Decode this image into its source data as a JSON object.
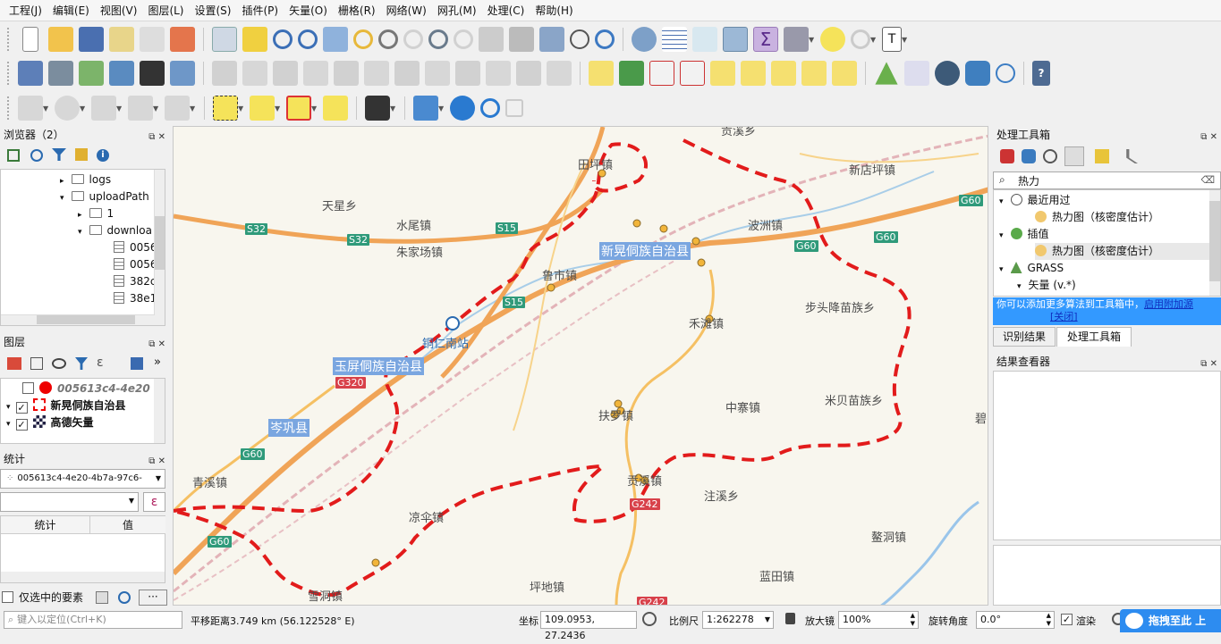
{
  "menus": [
    "工程(J)",
    "编辑(E)",
    "视图(V)",
    "图层(L)",
    "设置(S)",
    "插件(P)",
    "矢量(O)",
    "栅格(R)",
    "网络(W)",
    "网孔(M)",
    "处理(C)",
    "帮助(H)"
  ],
  "browser": {
    "title": "浏览器（2）",
    "items": [
      {
        "label": "logs",
        "kind": "folder"
      },
      {
        "label": "uploadPath",
        "kind": "folder"
      },
      {
        "label": "1",
        "kind": "folder"
      },
      {
        "label": "downloa",
        "kind": "folder"
      },
      {
        "label": "0056",
        "kind": "table"
      },
      {
        "label": "0056",
        "kind": "table"
      },
      {
        "label": "382c",
        "kind": "table"
      },
      {
        "label": "38e1",
        "kind": "table"
      }
    ]
  },
  "layers": {
    "title": "图层",
    "items": [
      {
        "label": "005613c4-4e20",
        "checked": false
      },
      {
        "label": "新晃侗族自治县",
        "checked": true
      },
      {
        "label": "高德矢量",
        "checked": true
      }
    ]
  },
  "stats": {
    "title": "统计",
    "layer": "005613c4-4e20-4b7a-97c6-",
    "col_stat": "统计",
    "col_value": "值",
    "only_selected": "仅选中的要素"
  },
  "toolbox": {
    "title": "处理工具箱",
    "search": "热力",
    "tree": [
      {
        "label": "最近用过",
        "level": 0
      },
      {
        "label": "热力图（核密度估计）",
        "level": 1
      },
      {
        "label": "插值",
        "level": 0
      },
      {
        "label": "热力图（核密度估计）",
        "level": 1
      },
      {
        "label": "GRASS",
        "level": 0
      },
      {
        "label": "矢量 (v.*)",
        "level": 1
      }
    ],
    "info_text": "你可以添加更多算法到工具箱中，",
    "info_link": "启用附加源",
    "info_close": "[关闭]",
    "tab1": "识别结果",
    "tab2": "处理工具箱"
  },
  "results": {
    "title": "结果查看器"
  },
  "status": {
    "locate_placeholder": "键入以定位(Ctrl+K)",
    "pan": "平移距离3.749 km (56.122528° E)",
    "coord_label": "坐标",
    "coord": "109.0953, 27.2436",
    "scale_label": "比例尺",
    "scale": "1:262278",
    "mag_label": "放大镜",
    "mag": "100%",
    "rot_label": "旋转角度",
    "rot": "0.0°",
    "render": "渲染",
    "promo": "拖拽至此 上"
  },
  "map": {
    "labels": [
      "天星乡",
      "水尾镇",
      "朱家场镇",
      "田坪镇",
      "新店坪镇",
      "波洲镇",
      "鲁市镇",
      "禾滩镇",
      "步头降苗族乡",
      "铜仁南站",
      "扶罗镇",
      "中寨镇",
      "米贝苗族乡",
      "青溪镇",
      "贡溪镇",
      "注溪乡",
      "凉伞镇",
      "坪地镇",
      "蓝田镇",
      "雪洞镇",
      "鳌洞镇",
      "贡溪乡",
      "碧"
    ],
    "highlight": [
      "新晃侗族自治县",
      "玉屏侗族自治县",
      "岑巩县"
    ],
    "roads": [
      "S32",
      "S32",
      "S15",
      "S15",
      "G60",
      "G60",
      "G60",
      "G60",
      "G60",
      "G320",
      "G242",
      "G242"
    ]
  }
}
